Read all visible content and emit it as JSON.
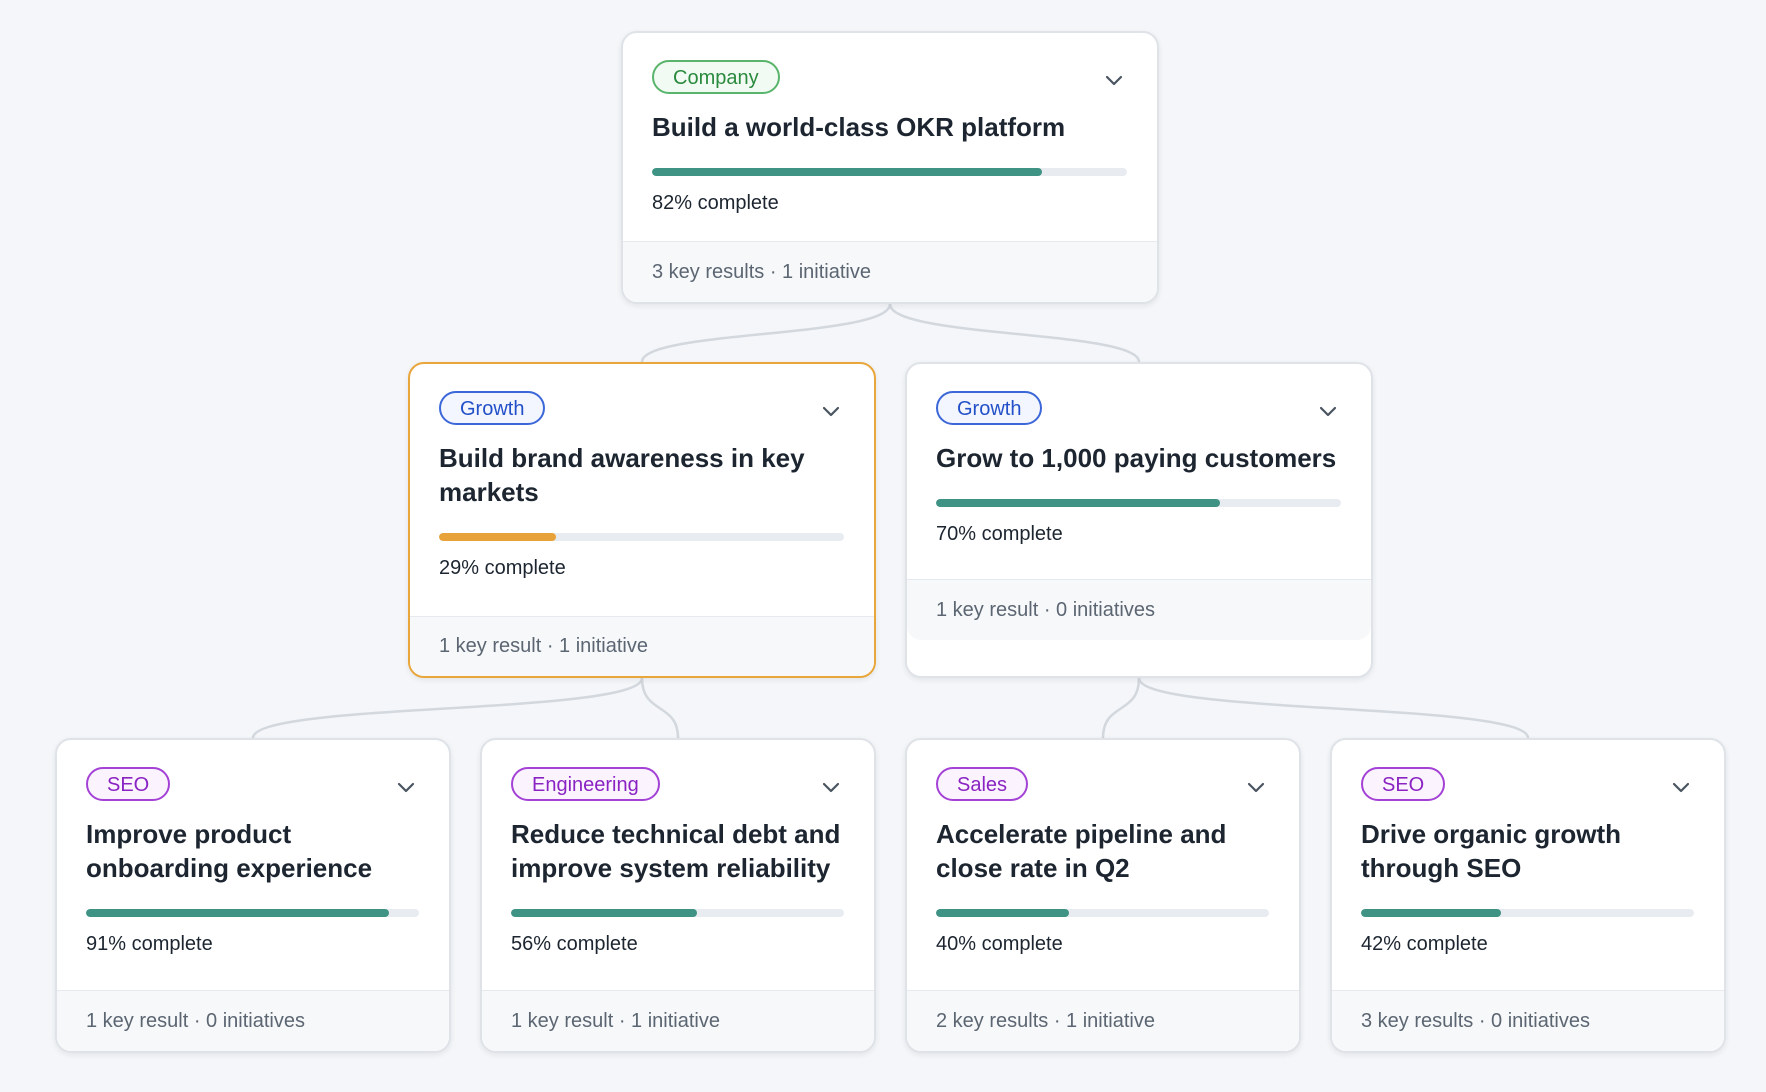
{
  "accent": {
    "track_fill": "#3f9384",
    "at_risk_fill": "#e7a23a",
    "selected_border": "#e9a63a"
  },
  "root": {
    "tag": "Company",
    "title": "Build a world-class OKR platform",
    "progress": 82,
    "progress_label": "82% complete",
    "summary": "3 key results · 1 initiative"
  },
  "level2": [
    {
      "tag": "Growth",
      "title": "Build brand awareness in key markets",
      "progress": 29,
      "progress_label": "29% complete",
      "summary": "1 key result · 1 initiative",
      "status": "at-risk",
      "selected": true
    },
    {
      "tag": "Growth",
      "title": "Grow to 1,000 paying customers",
      "progress": 70,
      "progress_label": "70% complete",
      "summary": "1 key result · 0 initiatives"
    }
  ],
  "level3": [
    {
      "tag": "SEO",
      "title": "Improve product onboarding experience",
      "progress": 91,
      "progress_label": "91% complete",
      "summary": "1 key result · 0 initiatives"
    },
    {
      "tag": "Engineering",
      "title": "Reduce technical debt and improve system reliability",
      "progress": 56,
      "progress_label": "56% complete",
      "summary": "1 key result · 1 initiative"
    },
    {
      "tag": "Sales",
      "title": "Accelerate pipeline and close rate in Q2",
      "progress": 40,
      "progress_label": "40% complete",
      "summary": "2 key results · 1 initiative"
    },
    {
      "tag": "SEO",
      "title": "Drive organic growth through SEO",
      "progress": 42,
      "progress_label": "42% complete",
      "summary": "3 key results · 0 initiatives"
    }
  ]
}
